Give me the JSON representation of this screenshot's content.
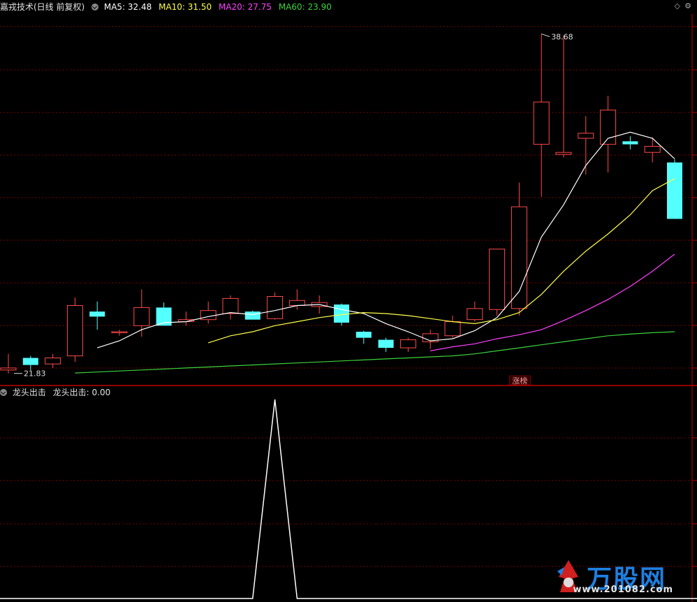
{
  "header": {
    "title": "嘉戎技术(日线 前复权)",
    "indicators": [
      {
        "label": "MA5: 32.48",
        "color": "#ffffff"
      },
      {
        "label": "MA10: 31.50",
        "color": "#ffff4a"
      },
      {
        "label": "MA20: 27.75",
        "color": "#ff40ff"
      },
      {
        "label": "MA60: 23.90",
        "color": "#3cd23c"
      }
    ]
  },
  "sub_header": {
    "title": "龙头出击",
    "value_label": "龙头出击: 0.00"
  },
  "annotations": {
    "high_label": "38.68",
    "low_label": "21.83",
    "event_label": "涨榜"
  },
  "logo": {
    "text": "万股网",
    "url": "www.201082.com"
  },
  "colors": {
    "up": "#ff4a4a",
    "down": "#54ffff",
    "grid": "#7a0000",
    "divider": "#c00000"
  },
  "chart_data": [
    {
      "type": "candlestick",
      "title": "嘉戎技术(日线 前复权)",
      "ylim": [
        21.3,
        39.6
      ],
      "candles": [
        {
          "o": 22.0,
          "h": 22.8,
          "l": 21.83,
          "c": 22.1
        },
        {
          "o": 22.6,
          "h": 22.7,
          "l": 22.0,
          "c": 22.25
        },
        {
          "o": 22.3,
          "h": 22.8,
          "l": 22.1,
          "c": 22.6
        },
        {
          "o": 22.7,
          "h": 25.6,
          "l": 22.4,
          "c": 25.2
        },
        {
          "o": 24.9,
          "h": 25.4,
          "l": 24.0,
          "c": 24.65
        },
        {
          "o": 23.85,
          "h": 24.0,
          "l": 23.7,
          "c": 23.9
        },
        {
          "o": 24.2,
          "h": 26.0,
          "l": 23.65,
          "c": 25.1
        },
        {
          "o": 25.1,
          "h": 25.35,
          "l": 24.2,
          "c": 24.2
        },
        {
          "o": 24.4,
          "h": 24.9,
          "l": 24.2,
          "c": 24.5
        },
        {
          "o": 24.5,
          "h": 25.4,
          "l": 24.3,
          "c": 24.95
        },
        {
          "o": 24.8,
          "h": 25.7,
          "l": 24.5,
          "c": 25.55
        },
        {
          "o": 24.9,
          "h": 24.95,
          "l": 24.5,
          "c": 24.5
        },
        {
          "o": 24.55,
          "h": 25.85,
          "l": 24.5,
          "c": 25.65
        },
        {
          "o": 25.2,
          "h": 26.0,
          "l": 25.0,
          "c": 25.45
        },
        {
          "o": 25.15,
          "h": 25.7,
          "l": 24.8,
          "c": 25.35
        },
        {
          "o": 25.25,
          "h": 25.3,
          "l": 24.2,
          "c": 24.35
        },
        {
          "o": 23.9,
          "h": 23.95,
          "l": 23.3,
          "c": 23.6
        },
        {
          "o": 23.5,
          "h": 23.6,
          "l": 22.9,
          "c": 23.1
        },
        {
          "o": 23.1,
          "h": 23.6,
          "l": 22.9,
          "c": 23.5
        },
        {
          "o": 23.4,
          "h": 24.0,
          "l": 23.05,
          "c": 23.8
        },
        {
          "o": 23.7,
          "h": 24.7,
          "l": 23.6,
          "c": 24.4
        },
        {
          "o": 24.5,
          "h": 25.4,
          "l": 24.4,
          "c": 25.05
        },
        {
          "o": 25.0,
          "h": 26.6,
          "l": 24.7,
          "c": 28.0
        },
        {
          "o": 25.05,
          "h": 31.3,
          "l": 24.7,
          "c": 30.1
        },
        {
          "o": 33.2,
          "h": 38.68,
          "l": 30.6,
          "c": 35.3
        },
        {
          "o": 32.7,
          "h": 38.6,
          "l": 32.55,
          "c": 32.8
        },
        {
          "o": 33.5,
          "h": 34.6,
          "l": 31.7,
          "c": 33.75
        },
        {
          "o": 33.2,
          "h": 35.6,
          "l": 31.8,
          "c": 34.9
        },
        {
          "o": 33.35,
          "h": 33.6,
          "l": 32.95,
          "c": 33.2
        },
        {
          "o": 32.8,
          "h": 33.55,
          "l": 32.3,
          "c": 33.1
        },
        {
          "o": 32.3,
          "h": 32.45,
          "l": 29.6,
          "c": 29.5
        }
      ],
      "series": [
        {
          "name": "MA5",
          "values": [
            null,
            null,
            null,
            null,
            23.1,
            23.45,
            24.0,
            24.35,
            24.4,
            24.65,
            24.85,
            24.75,
            24.95,
            25.2,
            25.25,
            25.0,
            24.8,
            24.3,
            23.9,
            23.45,
            23.55,
            23.95,
            24.6,
            25.9,
            28.6,
            30.2,
            32.15,
            33.5,
            33.8,
            33.5,
            32.48
          ]
        },
        {
          "name": "MA10",
          "values": [
            null,
            null,
            null,
            null,
            null,
            null,
            null,
            null,
            null,
            23.35,
            23.7,
            23.9,
            24.2,
            24.4,
            24.6,
            24.75,
            24.85,
            24.8,
            24.7,
            24.55,
            24.4,
            24.3,
            24.5,
            24.85,
            25.75,
            26.9,
            27.9,
            28.75,
            29.7,
            30.9,
            31.5
          ]
        },
        {
          "name": "MA20",
          "values": [
            null,
            null,
            null,
            null,
            null,
            null,
            null,
            null,
            null,
            null,
            null,
            null,
            null,
            null,
            null,
            null,
            null,
            null,
            null,
            22.95,
            23.15,
            23.3,
            23.55,
            23.75,
            24.0,
            24.45,
            24.95,
            25.5,
            26.15,
            26.9,
            27.75
          ]
        },
        {
          "name": "MA60",
          "values": [
            null,
            null,
            null,
            21.85,
            21.9,
            21.95,
            22.0,
            22.05,
            22.1,
            22.15,
            22.2,
            22.25,
            22.3,
            22.35,
            22.4,
            22.45,
            22.5,
            22.55,
            22.6,
            22.65,
            22.7,
            22.8,
            22.95,
            23.1,
            23.25,
            23.4,
            23.55,
            23.7,
            23.78,
            23.85,
            23.9
          ]
        }
      ]
    },
    {
      "type": "line",
      "title": "龙头出击",
      "ylim": [
        0,
        1
      ],
      "series": [
        {
          "name": "龙头出击",
          "values": [
            0,
            0,
            0,
            0,
            0,
            0,
            0,
            0,
            0,
            0,
            0,
            0,
            1,
            0,
            0,
            0,
            0,
            0,
            0,
            0,
            0,
            0,
            0,
            0,
            0,
            0,
            0,
            0,
            0,
            0,
            0
          ]
        }
      ]
    }
  ]
}
